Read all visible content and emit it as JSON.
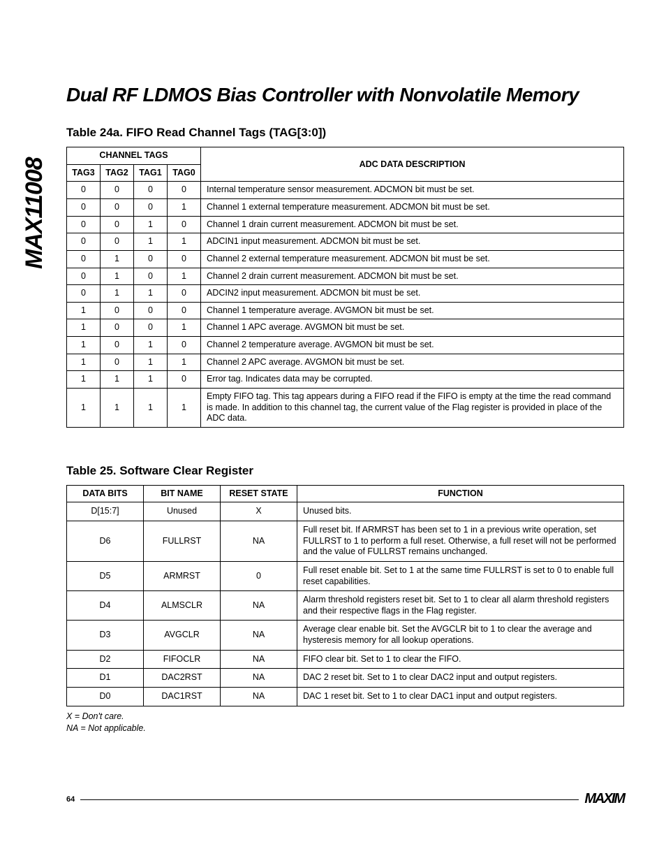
{
  "part_number": "MAX11008",
  "title": "Dual RF LDMOS Bias Controller with Nonvolatile Memory",
  "table24a": {
    "caption": "Table 24a. FIFO Read Channel Tags (TAG[3:0])",
    "col_group": "CHANNEL TAGS",
    "cols": [
      "TAG3",
      "TAG2",
      "TAG1",
      "TAG0"
    ],
    "desc_header": "ADC DATA DESCRIPTION",
    "rows": [
      {
        "t": [
          "0",
          "0",
          "0",
          "0"
        ],
        "d": "Internal temperature sensor measurement. ADCMON bit must be set."
      },
      {
        "t": [
          "0",
          "0",
          "0",
          "1"
        ],
        "d": "Channel 1 external temperature measurement. ADCMON bit must be set."
      },
      {
        "t": [
          "0",
          "0",
          "1",
          "0"
        ],
        "d": "Channel 1 drain current measurement. ADCMON bit must be set."
      },
      {
        "t": [
          "0",
          "0",
          "1",
          "1"
        ],
        "d": "ADCIN1 input measurement. ADCMON bit must be set."
      },
      {
        "t": [
          "0",
          "1",
          "0",
          "0"
        ],
        "d": "Channel 2 external temperature measurement. ADCMON bit must be set."
      },
      {
        "t": [
          "0",
          "1",
          "0",
          "1"
        ],
        "d": "Channel 2 drain current measurement. ADCMON bit must be set."
      },
      {
        "t": [
          "0",
          "1",
          "1",
          "0"
        ],
        "d": "ADCIN2 input measurement. ADCMON bit must be set."
      },
      {
        "t": [
          "1",
          "0",
          "0",
          "0"
        ],
        "d": "Channel 1 temperature average. AVGMON bit must be set."
      },
      {
        "t": [
          "1",
          "0",
          "0",
          "1"
        ],
        "d": "Channel 1 APC average. AVGMON bit must be set."
      },
      {
        "t": [
          "1",
          "0",
          "1",
          "0"
        ],
        "d": "Channel 2 temperature average. AVGMON bit must be set."
      },
      {
        "t": [
          "1",
          "0",
          "1",
          "1"
        ],
        "d": "Channel 2 APC average. AVGMON bit must be set."
      },
      {
        "t": [
          "1",
          "1",
          "1",
          "0"
        ],
        "d": "Error tag. Indicates data may be corrupted."
      },
      {
        "t": [
          "1",
          "1",
          "1",
          "1"
        ],
        "d": "Empty FIFO tag. This tag appears during a FIFO read if the FIFO is empty at the time the read command is made. In addition to this channel tag, the current value of the Flag register is provided in place of the ADC data."
      }
    ]
  },
  "table25": {
    "caption": "Table 25. Software Clear Register",
    "headers": [
      "DATA BITS",
      "BIT NAME",
      "RESET STATE",
      "FUNCTION"
    ],
    "rows": [
      {
        "b": "D[15:7]",
        "n": "Unused",
        "r": "X",
        "f": "Unused bits."
      },
      {
        "b": "D6",
        "n": "FULLRST",
        "r": "NA",
        "f": "Full reset bit. If ARMRST has been set to 1 in a previous write operation, set FULLRST to 1 to perform a full reset. Otherwise, a full reset will not be performed and the value of FULLRST remains unchanged."
      },
      {
        "b": "D5",
        "n": "ARMRST",
        "r": "0",
        "f": "Full reset enable bit. Set to 1 at the same time FULLRST is set to 0 to enable full reset capabilities."
      },
      {
        "b": "D4",
        "n": "ALMSCLR",
        "r": "NA",
        "f": "Alarm threshold registers reset bit. Set to 1 to clear all alarm threshold registers and their respective flags in the Flag register."
      },
      {
        "b": "D3",
        "n": "AVGCLR",
        "r": "NA",
        "f": "Average clear enable bit. Set the AVGCLR bit to 1 to clear the average and hysteresis memory for all lookup operations."
      },
      {
        "b": "D2",
        "n": "FIFOCLR",
        "r": "NA",
        "f": "FIFO clear bit. Set to 1 to clear the FIFO."
      },
      {
        "b": "D1",
        "n": "DAC2RST",
        "r": "NA",
        "f": "DAC 2 reset bit. Set to 1 to clear DAC2 input and output registers."
      },
      {
        "b": "D0",
        "n": "DAC1RST",
        "r": "NA",
        "f": "DAC 1 reset bit. Set to 1 to clear DAC1 input and output registers."
      }
    ],
    "footnotes": [
      "X = Don't care.",
      "NA = Not applicable."
    ]
  },
  "footer": {
    "page": "64",
    "logo": "MAXIM"
  }
}
